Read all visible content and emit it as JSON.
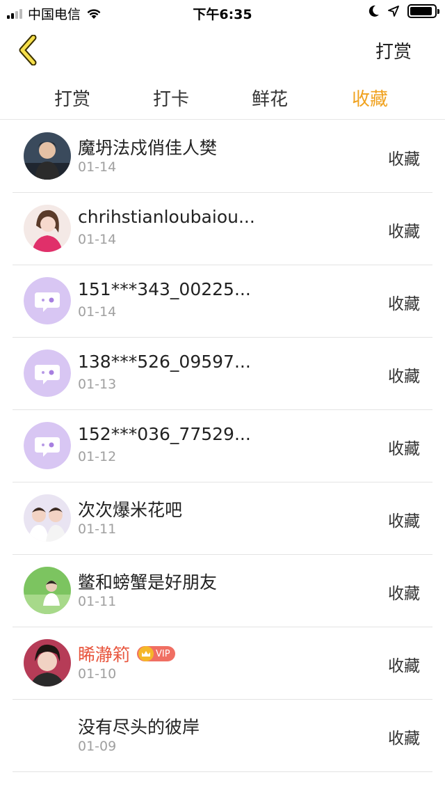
{
  "status_bar": {
    "carrier": "中国电信",
    "time": "下午6:35",
    "battery_level": 0.92
  },
  "nav": {
    "back_icon": "chevron-left-icon",
    "action_label": "打赏"
  },
  "tabs": [
    {
      "label": "打赏",
      "active": false
    },
    {
      "label": "打卡",
      "active": false
    },
    {
      "label": "鲜花",
      "active": false
    },
    {
      "label": "收藏",
      "active": true
    }
  ],
  "colors": {
    "accent": "#f0a21f",
    "vip_name": "#e8553d",
    "placeholder_avatar": "#d8c6f3"
  },
  "rows": [
    {
      "name": "魔坍法戍俏佳人樊",
      "date": "01-14",
      "action": "收藏",
      "avatar": "photo-dark"
    },
    {
      "name": "chrihstianloubaiou...",
      "date": "01-14",
      "action": "收藏",
      "avatar": "photo-pink"
    },
    {
      "name": "151***343_00225...",
      "date": "01-14",
      "action": "收藏",
      "avatar": "chat-bubble-placeholder"
    },
    {
      "name": "138***526_09597...",
      "date": "01-13",
      "action": "收藏",
      "avatar": "chat-bubble-placeholder"
    },
    {
      "name": "152***036_77529...",
      "date": "01-12",
      "action": "收藏",
      "avatar": "chat-bubble-placeholder"
    },
    {
      "name": "次次爆米花吧",
      "date": "01-11",
      "action": "收藏",
      "avatar": "photo-pair"
    },
    {
      "name": "鳖和螃蟹是好朋友",
      "date": "01-11",
      "action": "收藏",
      "avatar": "photo-green"
    },
    {
      "name": "睎瀞筣",
      "date": "01-10",
      "action": "收藏",
      "avatar": "photo-portrait",
      "vip": true,
      "vip_label": "VIP"
    },
    {
      "name": "没有尽头的彼岸",
      "date": "01-09",
      "action": "收藏",
      "avatar": "none"
    }
  ]
}
